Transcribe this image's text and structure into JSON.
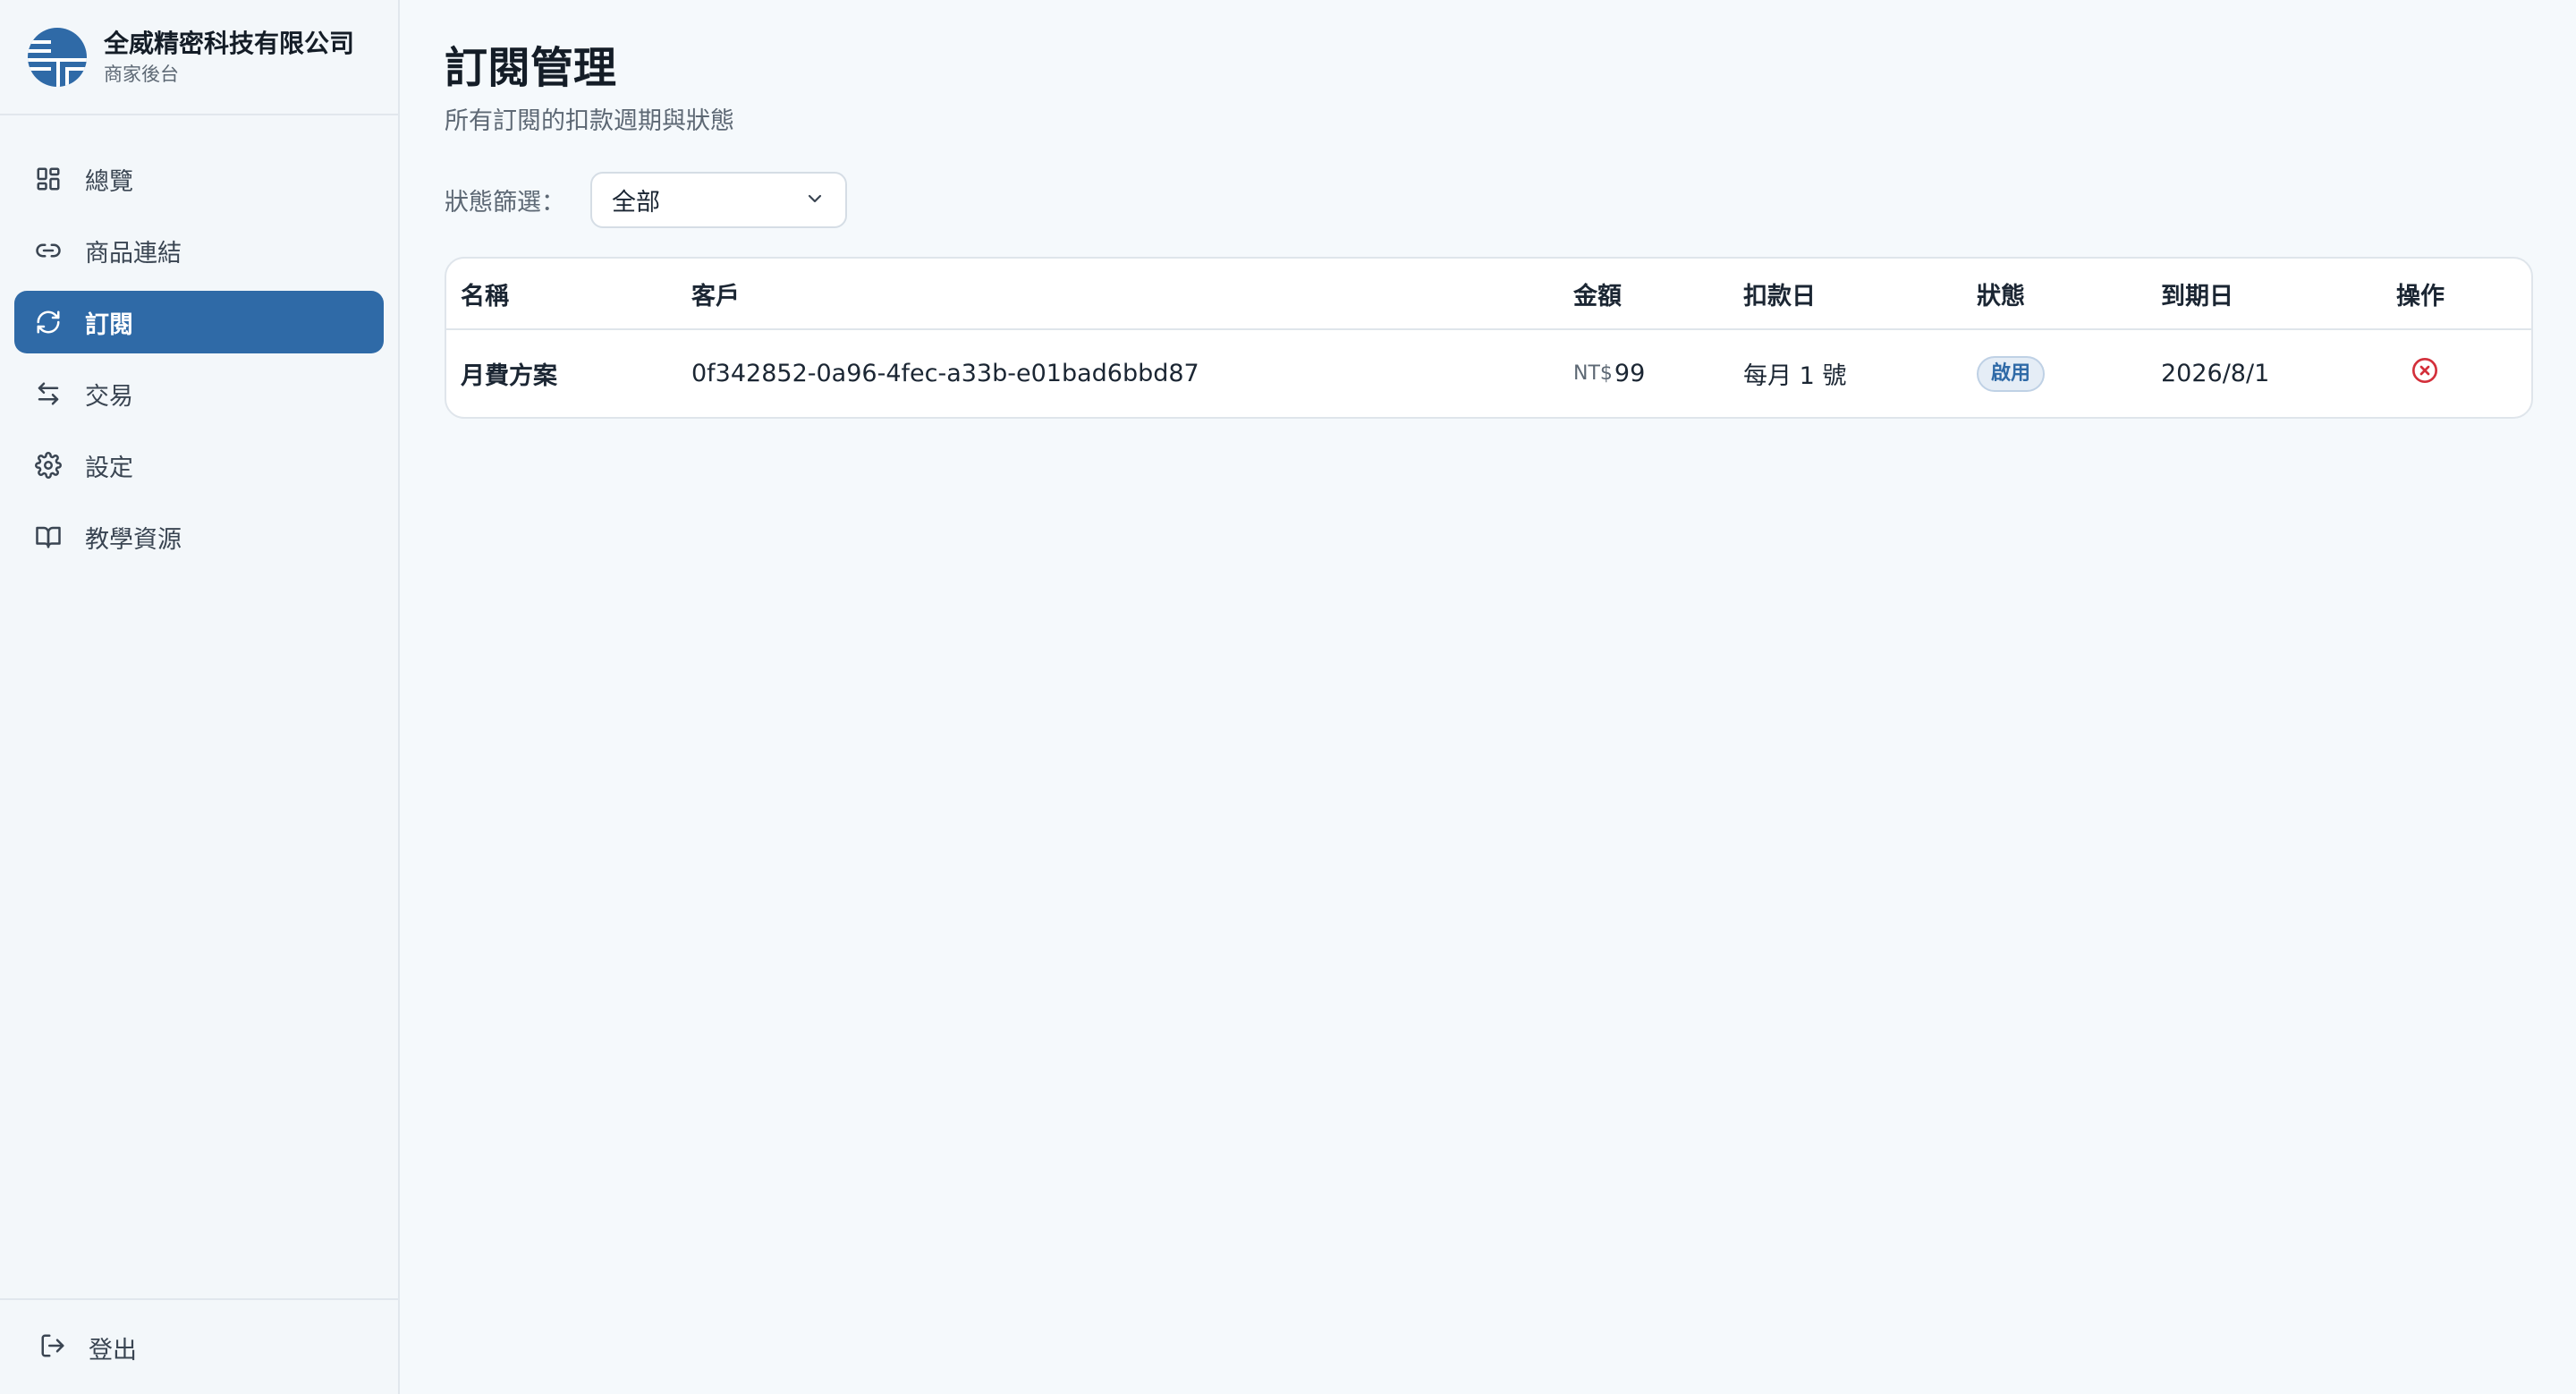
{
  "brand": {
    "name": "全威精密科技有限公司",
    "subtitle": "商家後台"
  },
  "sidebar": {
    "items": [
      {
        "label": "總覽",
        "icon": "dashboard-icon",
        "active": false
      },
      {
        "label": "商品連結",
        "icon": "link-icon",
        "active": false
      },
      {
        "label": "訂閱",
        "icon": "refresh-icon",
        "active": true
      },
      {
        "label": "交易",
        "icon": "arrows-left-right-icon",
        "active": false
      },
      {
        "label": "設定",
        "icon": "gear-icon",
        "active": false
      },
      {
        "label": "教學資源",
        "icon": "book-icon",
        "active": false
      }
    ],
    "logout_label": "登出"
  },
  "page": {
    "title": "訂閱管理",
    "subtitle": "所有訂閱的扣款週期與狀態"
  },
  "filter": {
    "label": "狀態篩選：",
    "selected": "全部"
  },
  "table": {
    "headers": {
      "name": "名稱",
      "customer": "客戶",
      "amount": "金額",
      "billing_day": "扣款日",
      "status": "狀態",
      "expiry": "到期日",
      "action": "操作"
    },
    "rows": [
      {
        "name": "月費方案",
        "customer": "0f342852-0a96-4fec-a33b-e01bad6bbd87",
        "currency": "NT$",
        "amount": "99",
        "billing_day": "每月 1 號",
        "status": "啟用",
        "expiry": "2026/8/1"
      }
    ]
  },
  "colors": {
    "accent": "#2f6aa7",
    "danger": "#d32f3a",
    "background": "#f5f9fc"
  }
}
